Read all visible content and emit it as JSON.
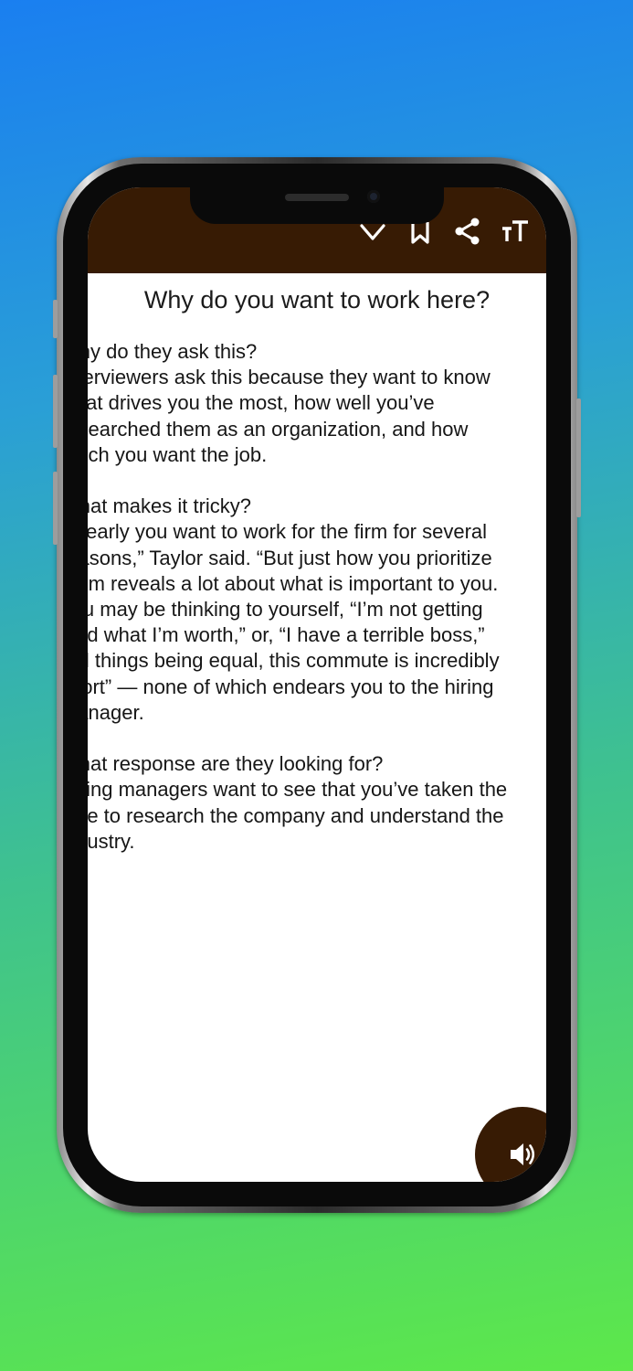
{
  "colors": {
    "accent": "#371b04",
    "background_top": "#1a7ff0",
    "background_bottom": "#5de84a"
  },
  "toolbar": {
    "icons": [
      "heart-icon",
      "bookmark-icon",
      "share-icon",
      "text-size-icon"
    ]
  },
  "article": {
    "title": "Why do you want to work here?",
    "lines": [
      "Why do they ask this?",
      "Interviewers ask this because they want to know",
      "what drives you the most, how well you’ve",
      "researched them as an organization, and how",
      "much you want the job.",
      "",
      "What makes it tricky?",
      "“Clearly you want to work for the firm for several",
      "reasons,” Taylor said. “But just how you prioritize",
      "them reveals a lot about what is important to you.",
      "You may be thinking to yourself, “I’m not getting",
      "paid what I’m worth,” or, “I have a terrible boss,”",
      "“All things being equal, this commute is incredibly",
      "short” — none of which endears you to the hiring",
      "manager.",
      "",
      "What response are they looking for?",
      "Hiring managers want to see that you’ve taken the",
      "time to research the company and understand the",
      "industry."
    ]
  },
  "audio_button": {
    "icon": "speaker-icon"
  }
}
